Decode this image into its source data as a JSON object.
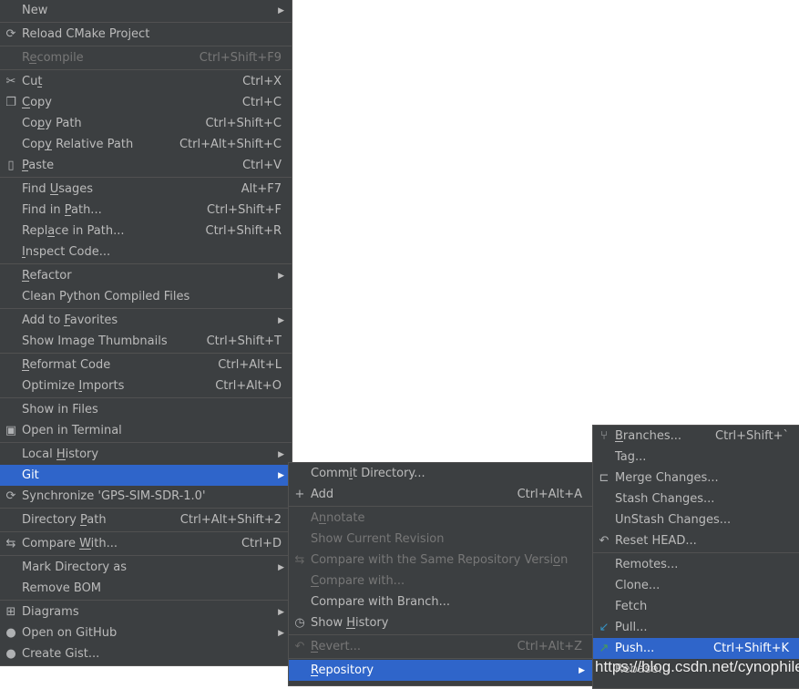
{
  "colors": {
    "menu_bg": "#3c3f41",
    "text": "#bbbbbb",
    "disabled": "#777777",
    "selection": "#2f65ca",
    "separator": "#515151",
    "pull_icon": "#3592c4",
    "push_icon": "#499c54"
  },
  "main_menu": [
    {
      "label": "New",
      "submenu": true
    },
    {
      "sep": true
    },
    {
      "label": "Reload CMake Project",
      "icon": "reload-icon"
    },
    {
      "sep": true
    },
    {
      "label": "Recompile",
      "shortcut": "Ctrl+Shift+F9",
      "disabled": true,
      "mn": 1
    },
    {
      "sep": true
    },
    {
      "label": "Cut",
      "shortcut": "Ctrl+X",
      "icon": "scissors-icon",
      "mn": 2
    },
    {
      "label": "Copy",
      "shortcut": "Ctrl+C",
      "icon": "copy-icon",
      "mn": 0
    },
    {
      "label": "Copy Path",
      "shortcut": "Ctrl+Shift+C",
      "mn": 2
    },
    {
      "label": "Copy Relative Path",
      "shortcut": "Ctrl+Alt+Shift+C",
      "mn": 3
    },
    {
      "label": "Paste",
      "shortcut": "Ctrl+V",
      "icon": "paste-icon",
      "mn": 0
    },
    {
      "sep": true
    },
    {
      "label": "Find Usages",
      "shortcut": "Alt+F7",
      "mn": 5
    },
    {
      "label": "Find in Path...",
      "shortcut": "Ctrl+Shift+F",
      "mn": 8
    },
    {
      "label": "Replace in Path...",
      "shortcut": "Ctrl+Shift+R",
      "mn": 4
    },
    {
      "label": "Inspect Code...",
      "mn": 0
    },
    {
      "sep": true
    },
    {
      "label": "Refactor",
      "submenu": true,
      "mn": 0
    },
    {
      "label": "Clean Python Compiled Files"
    },
    {
      "sep": true
    },
    {
      "label": "Add to Favorites",
      "submenu": true,
      "mn": 7
    },
    {
      "label": "Show Image Thumbnails",
      "shortcut": "Ctrl+Shift+T"
    },
    {
      "sep": true
    },
    {
      "label": "Reformat Code",
      "shortcut": "Ctrl+Alt+L",
      "mn": 0
    },
    {
      "label": "Optimize Imports",
      "shortcut": "Ctrl+Alt+O",
      "mn": 9
    },
    {
      "sep": true
    },
    {
      "label": "Show in Files"
    },
    {
      "label": "Open in Terminal",
      "icon": "terminal-icon"
    },
    {
      "sep": true
    },
    {
      "label": "Local History",
      "submenu": true,
      "mn": 6
    },
    {
      "label": "Git",
      "submenu": true,
      "selected": true
    },
    {
      "label": "Synchronize 'GPS-SIM-SDR-1.0'",
      "icon": "synchronize-icon"
    },
    {
      "sep": true
    },
    {
      "label": "Directory Path",
      "shortcut": "Ctrl+Alt+Shift+2",
      "mn": 10
    },
    {
      "sep": true
    },
    {
      "label": "Compare With...",
      "shortcut": "Ctrl+D",
      "icon": "compare-icon",
      "mn": 8
    },
    {
      "sep": true
    },
    {
      "label": "Mark Directory as",
      "submenu": true
    },
    {
      "label": "Remove BOM"
    },
    {
      "sep": true
    },
    {
      "label": "Diagrams",
      "submenu": true,
      "icon": "diagrams-icon"
    },
    {
      "label": "Open on GitHub",
      "submenu": true,
      "icon": "github-icon"
    },
    {
      "label": "Create Gist...",
      "icon": "github-icon"
    }
  ],
  "git_menu": [
    {
      "label": "Commit Directory...",
      "mn": 4
    },
    {
      "label": "Add",
      "shortcut": "Ctrl+Alt+A",
      "icon": "plus-icon"
    },
    {
      "sep": true
    },
    {
      "label": "Annotate",
      "disabled": true,
      "mn": 1
    },
    {
      "label": "Show Current Revision",
      "disabled": true
    },
    {
      "label": "Compare with the Same Repository Version",
      "disabled": true,
      "icon": "compare-icon",
      "mn": 38
    },
    {
      "label": "Compare with...",
      "disabled": true,
      "mn": 0
    },
    {
      "label": "Compare with Branch..."
    },
    {
      "label": "Show History",
      "icon": "clock-icon",
      "mn": 5
    },
    {
      "sep": true
    },
    {
      "label": "Revert...",
      "shortcut": "Ctrl+Alt+Z",
      "disabled": true,
      "icon": "revert-icon",
      "mn": 0
    },
    {
      "sep": true
    },
    {
      "label": "Repository",
      "submenu": true,
      "selected": true,
      "mn": 0
    }
  ],
  "repository_menu": [
    {
      "label": "Branches...",
      "shortcut": "Ctrl+Shift+`",
      "icon": "branch-icon",
      "mn": 0
    },
    {
      "label": "Tag..."
    },
    {
      "label": "Merge Changes...",
      "icon": "merge-icon"
    },
    {
      "label": "Stash Changes..."
    },
    {
      "label": "UnStash Changes..."
    },
    {
      "label": "Reset HEAD...",
      "icon": "reset-icon"
    },
    {
      "sep": true
    },
    {
      "label": "Remotes..."
    },
    {
      "label": "Clone..."
    },
    {
      "label": "Fetch"
    },
    {
      "label": "Pull...",
      "icon": "pull-icon"
    },
    {
      "label": "Push...",
      "shortcut": "Ctrl+Shift+K",
      "icon": "push-icon",
      "selected": true
    },
    {
      "label": "Rebase..."
    }
  ],
  "watermark": "https://blog.csdn.net/cynophile"
}
